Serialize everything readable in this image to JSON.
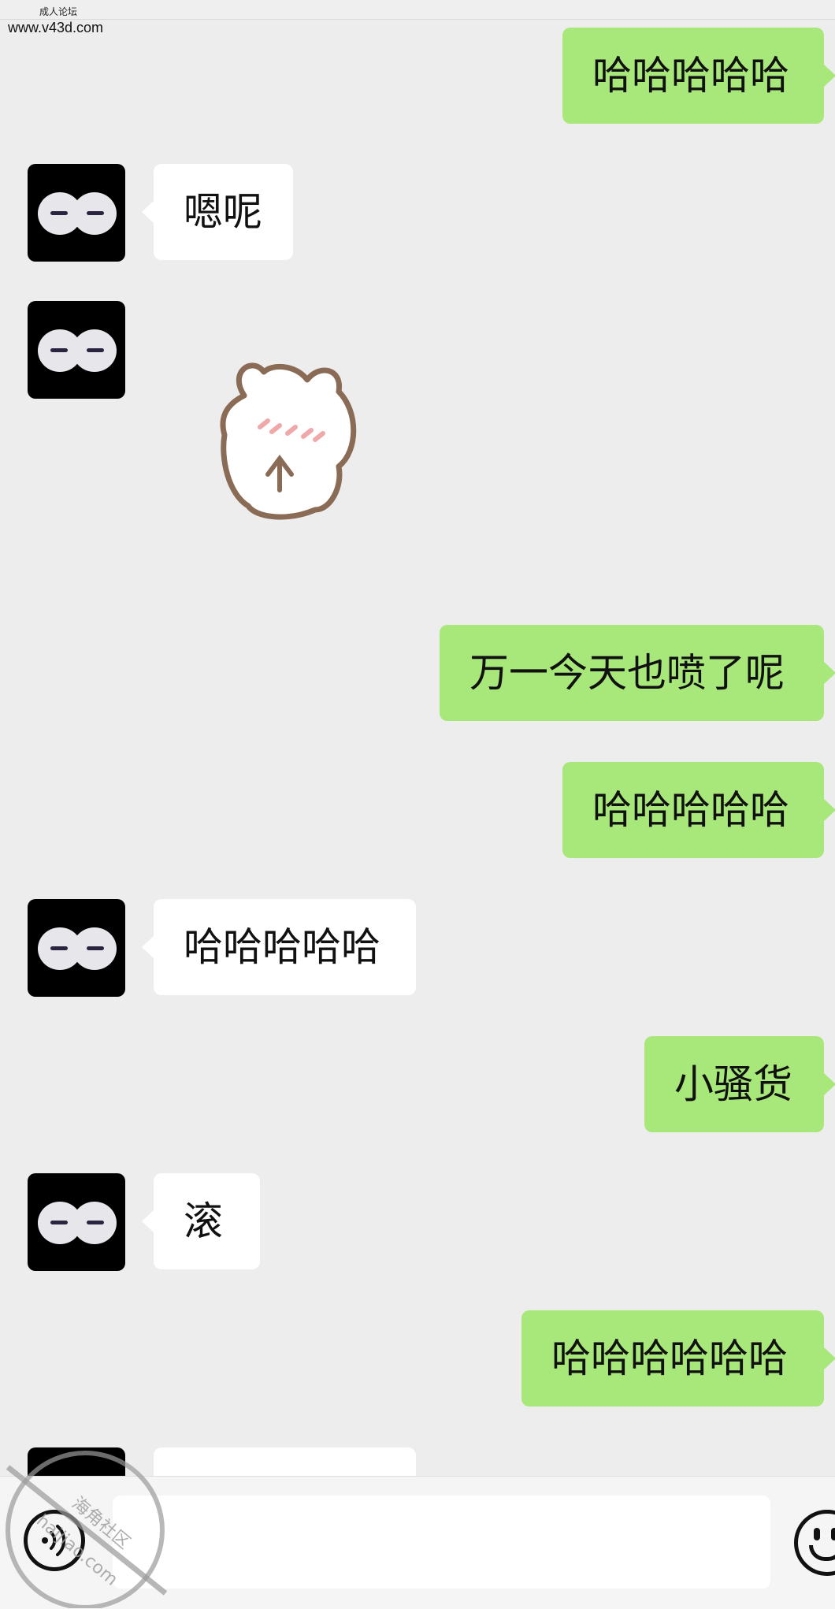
{
  "header": {
    "site_tag": "成人论坛",
    "site_url": "www.v43d.com"
  },
  "messages": [
    {
      "side": "sent",
      "text": "哈哈哈哈哈"
    },
    {
      "side": "received",
      "text": "嗯呢"
    },
    {
      "side": "received",
      "type": "sticker",
      "description": "bear-blushing-sticker"
    },
    {
      "side": "sent",
      "text": "万一今天也喷了呢"
    },
    {
      "side": "sent",
      "text": "哈哈哈哈哈"
    },
    {
      "side": "received",
      "text": "哈哈哈哈哈"
    },
    {
      "side": "sent",
      "text": "小骚货"
    },
    {
      "side": "received",
      "text": "滚"
    },
    {
      "side": "sent",
      "text": "哈哈哈哈哈哈"
    },
    {
      "side": "received",
      "text": ""
    }
  ],
  "input_bar": {
    "input_value": "",
    "voice_icon": "voice-icon",
    "emoji_icon": "emoji-icon"
  },
  "watermark": {
    "text_cn": "海角社区",
    "text_en": "haijiao.com"
  },
  "colors": {
    "background": "#ededed",
    "sent_bubble": "#a8e77a",
    "received_bubble": "#ffffff"
  }
}
